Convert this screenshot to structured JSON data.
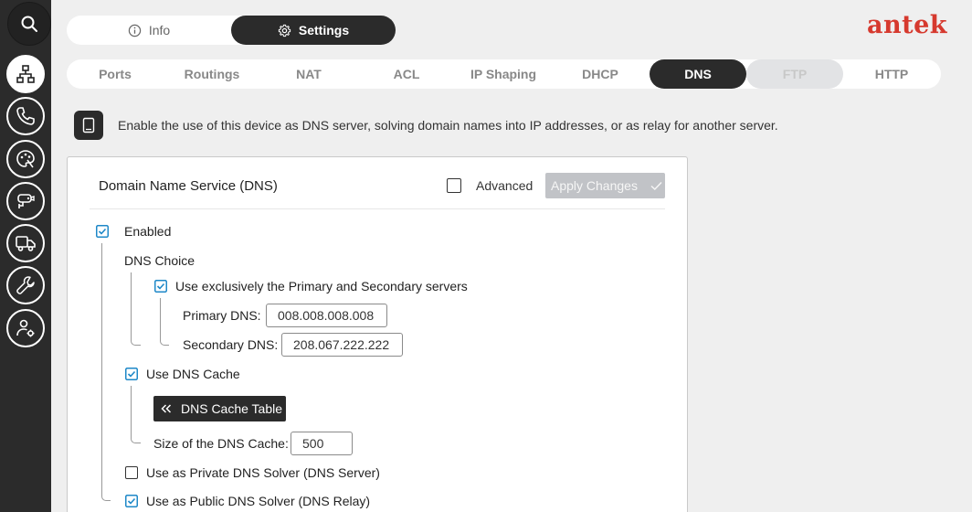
{
  "logo": "antek",
  "top_tabs": {
    "info": "Info",
    "settings": "Settings"
  },
  "subtabs": [
    "Ports",
    "Routings",
    "NAT",
    "ACL",
    "IP Shaping",
    "DHCP",
    "DNS",
    "FTP",
    "HTTP"
  ],
  "active_subtab": "DNS",
  "disabled_subtab": "FTP",
  "description": "Enable the use of this device as DNS server, solving domain names into IP addresses, or as relay for another server.",
  "panel": {
    "title": "Domain Name Service (DNS)",
    "advanced_label": "Advanced",
    "advanced_checked": false,
    "apply_label": "Apply Changes",
    "enabled_label": "Enabled",
    "enabled_checked": true,
    "dns_choice_label": "DNS Choice",
    "exclusive_label": "Use exclusively the Primary and Secondary servers",
    "exclusive_checked": true,
    "primary_label": "Primary DNS:",
    "primary_value": "008.008.008.008",
    "secondary_label": "Secondary DNS:",
    "secondary_value": "208.067.222.222",
    "cache_label": "Use DNS Cache",
    "cache_checked": true,
    "cache_table_label": "DNS Cache Table",
    "cache_size_label": "Size of the DNS Cache:",
    "cache_size_value": "500",
    "private_label": "Use as Private DNS Solver (DNS Server)",
    "private_checked": false,
    "public_label": "Use as Public DNS Solver (DNS Relay)",
    "public_checked": true
  },
  "colors": {
    "accent": "#2b2b2b",
    "logo": "#d6392e",
    "check": "#1e88c8"
  },
  "sidebar_icons": [
    "search-icon",
    "network-icon",
    "phone-icon",
    "palette-icon",
    "camera-icon",
    "truck-icon",
    "wrench-icon",
    "user-settings-icon"
  ]
}
